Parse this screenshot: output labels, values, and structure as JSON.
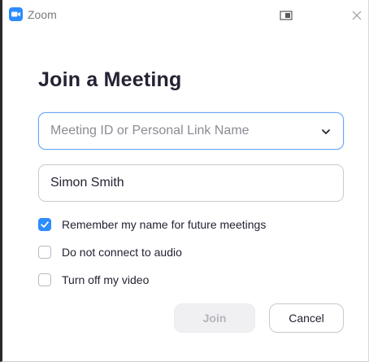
{
  "window": {
    "title": "Zoom",
    "accent_color": "#2d8cff"
  },
  "icons": {
    "app": "zoom-camera-icon",
    "layout": "window-layout-icon",
    "close": "close-icon",
    "dropdown": "chevron-down-icon",
    "check": "checkmark-icon"
  },
  "dialog": {
    "heading": "Join a Meeting"
  },
  "meeting_id": {
    "placeholder": "Meeting ID or Personal Link Name",
    "value": ""
  },
  "name": {
    "value": "Simon Smith"
  },
  "options": [
    {
      "label": "Remember my name for future meetings",
      "checked": true
    },
    {
      "label": "Do not connect to audio",
      "checked": false
    },
    {
      "label": "Turn off my video",
      "checked": false
    }
  ],
  "buttons": {
    "join_label": "Join",
    "join_enabled": false,
    "cancel_label": "Cancel"
  }
}
